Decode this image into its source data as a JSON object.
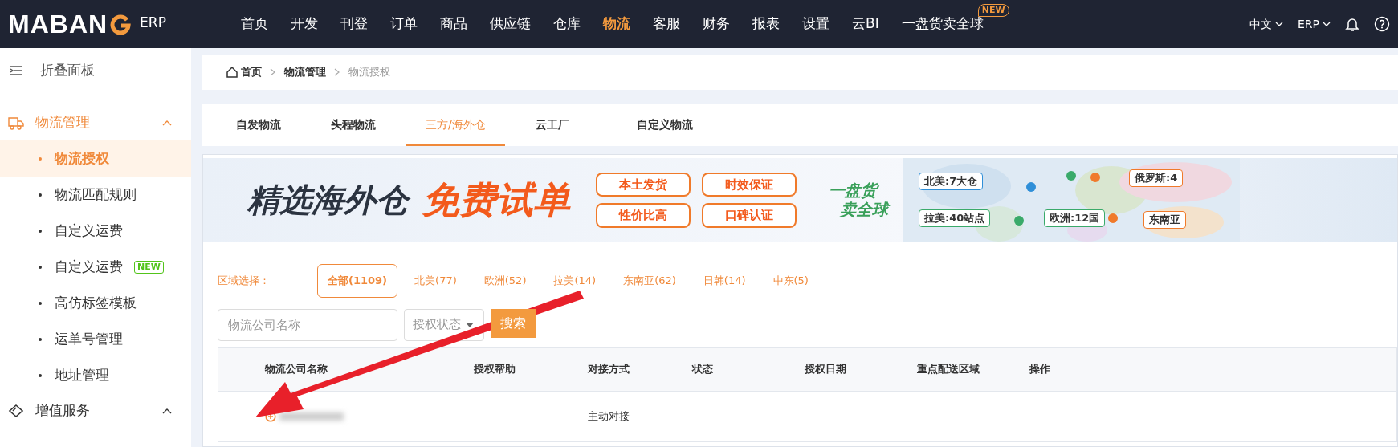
{
  "header": {
    "logo": "MABAN",
    "logo_suffix": "ERP",
    "nav": [
      {
        "label": "首页",
        "selected": false
      },
      {
        "label": "开发",
        "selected": false
      },
      {
        "label": "刊登",
        "selected": false
      },
      {
        "label": "订单",
        "selected": false
      },
      {
        "label": "商品",
        "selected": false
      },
      {
        "label": "供应链",
        "selected": false
      },
      {
        "label": "仓库",
        "selected": false
      },
      {
        "label": "物流",
        "selected": true
      },
      {
        "label": "客服",
        "selected": false
      },
      {
        "label": "财务",
        "selected": false
      },
      {
        "label": "报表",
        "selected": false
      },
      {
        "label": "设置",
        "selected": false
      },
      {
        "label": "云BI",
        "selected": false
      },
      {
        "label": "一盘货卖全球",
        "selected": false,
        "badge": "NEW"
      }
    ],
    "language": "中文",
    "product": "ERP"
  },
  "sidebar": {
    "collapse_label": "折叠面板",
    "groups": [
      {
        "label": "物流管理",
        "expanded": true,
        "active": true,
        "children": [
          {
            "label": "物流授权",
            "selected": true
          },
          {
            "label": "物流匹配规则",
            "selected": false
          },
          {
            "label": "自定义运费",
            "selected": false
          },
          {
            "label": "自定义运费",
            "selected": false,
            "badge": "NEW"
          },
          {
            "label": "高仿标签模板",
            "selected": false
          },
          {
            "label": "运单号管理",
            "selected": false
          },
          {
            "label": "地址管理",
            "selected": false
          }
        ]
      },
      {
        "label": "增值服务",
        "expanded": true,
        "active": false
      }
    ]
  },
  "breadcrumb": [
    {
      "label": "首页",
      "kind": "home"
    },
    {
      "label": "物流管理",
      "kind": "link"
    },
    {
      "label": "物流授权",
      "kind": "current"
    }
  ],
  "tabs": [
    {
      "label": "自发物流",
      "selected": false
    },
    {
      "label": "头程物流",
      "selected": false
    },
    {
      "label": "三方/海外仓",
      "selected": true
    },
    {
      "label": "云工厂",
      "selected": false
    },
    {
      "label": "自定义物流",
      "selected": false
    }
  ],
  "banner": {
    "title": "精选海外仓",
    "highlight": "免费试单",
    "tags": [
      "本土发货",
      "时效保证",
      "性价比高",
      "口碑认证"
    ],
    "slogan": [
      "一盘货",
      "卖全球"
    ],
    "map_labels": [
      {
        "label": "北美:7大仓",
        "color": "#2f8fd8"
      },
      {
        "label": "拉美:40站点",
        "color": "#3aaa6a"
      },
      {
        "label": "欧洲:12国",
        "color": "#3aaa6a"
      },
      {
        "label": "俄罗斯:4",
        "color": "#f07a2a"
      },
      {
        "label": "东南亚",
        "color": "#f07a2a"
      }
    ]
  },
  "region_filter": {
    "label": "区域选择：",
    "options": [
      {
        "label": "全部(1109)",
        "selected": true
      },
      {
        "label": "北美(77)",
        "selected": false
      },
      {
        "label": "欧洲(52)",
        "selected": false
      },
      {
        "label": "拉美(14)",
        "selected": false
      },
      {
        "label": "东南亚(62)",
        "selected": false
      },
      {
        "label": "日韩(14)",
        "selected": false
      },
      {
        "label": "中东(5)",
        "selected": false
      }
    ]
  },
  "search": {
    "placeholder": "物流公司名称",
    "status_placeholder": "授权状态",
    "button": "搜索"
  },
  "table": {
    "columns": [
      "物流公司名称",
      "授权帮助",
      "对接方式",
      "状态",
      "授权日期",
      "重点配送区域",
      "操作"
    ],
    "rows": [
      {
        "cells": [
          "",
          "",
          "主动对接",
          "",
          "",
          "",
          ""
        ],
        "redacted": true
      }
    ]
  },
  "annotation": {
    "kind": "arrow",
    "color": "#e8202a"
  }
}
